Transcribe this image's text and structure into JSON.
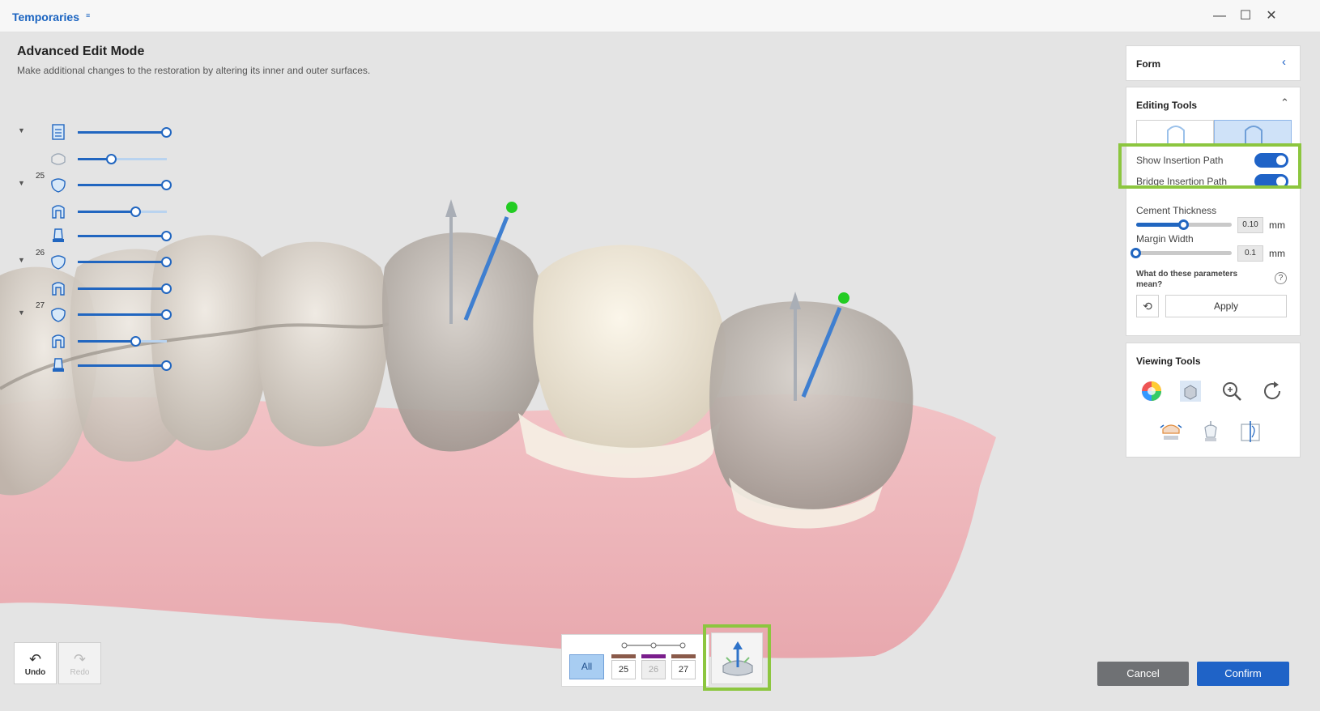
{
  "window": {
    "title": "Temporaries",
    "title_icon": "dental-arch-flag-icon",
    "controls": [
      "minimize-icon",
      "maximize-icon",
      "close-icon"
    ]
  },
  "mode": {
    "title": "Advanced Edit Mode",
    "description": "Make additional changes to the restoration by altering its inner and outer surfaces."
  },
  "layers": [
    {
      "tooth": "",
      "expandable": true,
      "icon": "jaw-scan-icon",
      "opacity": 1.0
    },
    {
      "tooth": "",
      "expandable": false,
      "icon": "antagonist-icon",
      "opacity": 0.38
    },
    {
      "tooth": "25",
      "expandable": true,
      "icon": "crown-icon",
      "opacity": 1.0
    },
    {
      "tooth": "",
      "expandable": false,
      "icon": "inner-surface-icon",
      "opacity": 0.65
    },
    {
      "tooth": "",
      "expandable": false,
      "icon": "abutment-icon",
      "opacity": 1.0
    },
    {
      "tooth": "26",
      "expandable": true,
      "icon": "crown-icon",
      "opacity": 1.0
    },
    {
      "tooth": "",
      "expandable": false,
      "icon": "inner-surface-icon",
      "opacity": 1.0
    },
    {
      "tooth": "27",
      "expandable": true,
      "icon": "crown-icon",
      "opacity": 1.0
    },
    {
      "tooth": "",
      "expandable": false,
      "icon": "inner-surface-icon",
      "opacity": 0.65
    },
    {
      "tooth": "",
      "expandable": false,
      "icon": "abutment-icon",
      "opacity": 1.0
    }
  ],
  "panel": {
    "form_label": "Form",
    "editing_tools_label": "Editing Tools",
    "show_insertion_path_label": "Show Insertion Path",
    "bridge_insertion_path_label": "Bridge Insertion Path",
    "cement_thickness_label": "Cement Thickness",
    "cement_thickness_value": "0.10",
    "cement_thickness_level": 0.5,
    "margin_width_label": "Margin Width",
    "margin_width_value": "0.1",
    "margin_width_level": 0.0,
    "unit": "mm",
    "help_text": "What do these parameters mean?",
    "help_icon": "?",
    "apply_label": "Apply",
    "viewing_tools_label": "Viewing Tools",
    "viewing_icons": [
      "color-wheel-icon",
      "solid-view-icon",
      "zoom-icon",
      "rotate-icon",
      "arch-expand-icon",
      "crown-view-icon",
      "section-view-icon"
    ]
  },
  "history": {
    "undo_label": "Undo",
    "redo_label": "Redo"
  },
  "tooth_selector": {
    "all_label": "All",
    "teeth": [
      {
        "label": "25",
        "color": "#8a5a4a",
        "enabled": true
      },
      {
        "label": "26",
        "color": "#7a1e8c",
        "enabled": false
      },
      {
        "label": "27",
        "color": "#8a5a4a",
        "enabled": true
      }
    ]
  },
  "actions": {
    "cancel_label": "Cancel",
    "confirm_label": "Confirm"
  },
  "colors": {
    "accent": "#1f63c7",
    "highlight": "#8cc63f",
    "insertion_tip": "#22cc22"
  }
}
